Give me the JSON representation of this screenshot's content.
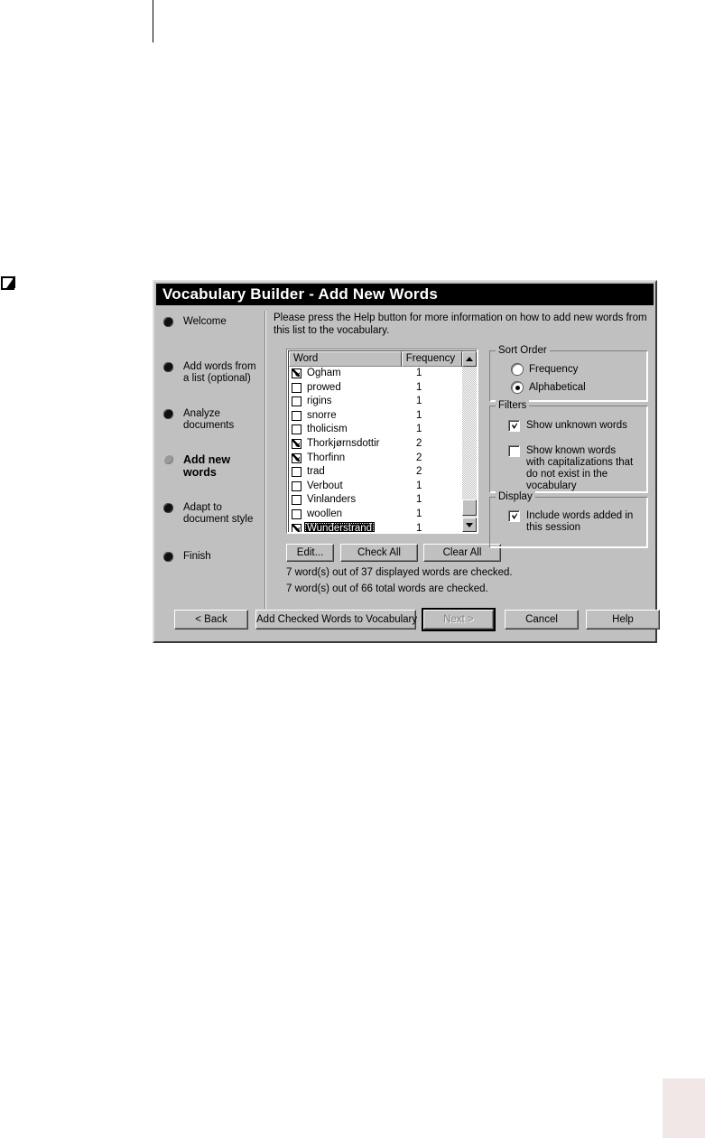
{
  "window": {
    "title": "Vocabulary Builder - Add New Words"
  },
  "steps": [
    {
      "label": "Welcome",
      "state": "done"
    },
    {
      "label": "Add words from a list (optional)",
      "state": "done"
    },
    {
      "label": "Analyze documents",
      "state": "done"
    },
    {
      "label": "Add new words",
      "state": "current"
    },
    {
      "label": "Adapt to document style",
      "state": "pending"
    },
    {
      "label": "Finish",
      "state": "pending"
    }
  ],
  "intro": "Please press the Help button for more information on how to add new words from this list to the vocabulary.",
  "list": {
    "columns": [
      "Word",
      "Frequency"
    ],
    "sort_indicator": "ascending-arrow",
    "rows": [
      {
        "checked": true,
        "word": "Ogham",
        "frequency": "1",
        "selected": false
      },
      {
        "checked": false,
        "word": "prowed",
        "frequency": "1",
        "selected": false
      },
      {
        "checked": false,
        "word": "rigins",
        "frequency": "1",
        "selected": false
      },
      {
        "checked": false,
        "word": "snorre",
        "frequency": "1",
        "selected": false
      },
      {
        "checked": false,
        "word": "tholicism",
        "frequency": "1",
        "selected": false
      },
      {
        "checked": true,
        "word": "Thorkjørnsdottir",
        "frequency": "2",
        "selected": false
      },
      {
        "checked": true,
        "word": "Thorfinn",
        "frequency": "2",
        "selected": false
      },
      {
        "checked": false,
        "word": "trad",
        "frequency": "2",
        "selected": false
      },
      {
        "checked": false,
        "word": "Verbout",
        "frequency": "1",
        "selected": false
      },
      {
        "checked": false,
        "word": "Vinlanders",
        "frequency": "1",
        "selected": false
      },
      {
        "checked": false,
        "word": "woollen",
        "frequency": "1",
        "selected": false
      },
      {
        "checked": true,
        "word": "Wunderstrand",
        "frequency": "1",
        "selected": true
      }
    ]
  },
  "list_buttons": {
    "edit": "Edit...",
    "check_all": "Check All",
    "clear_all": "Clear All"
  },
  "status": {
    "line1": "7 word(s) out of 37 displayed words are checked.",
    "line2": "7 word(s) out of 66 total words are checked."
  },
  "sort_order": {
    "title": "Sort Order",
    "options": [
      {
        "label": "Frequency",
        "selected": false
      },
      {
        "label": "Alphabetical",
        "selected": true
      }
    ]
  },
  "filters": {
    "title": "Filters",
    "options": [
      {
        "label": "Show unknown words",
        "checked": true
      },
      {
        "label": "Show known words with capitalizations that do not exist in the vocabulary",
        "checked": false
      }
    ]
  },
  "display": {
    "title": "Display",
    "options": [
      {
        "label": "Include words added in this session",
        "checked": true
      }
    ]
  },
  "bottom_buttons": {
    "back": "< Back",
    "add": "Add Checked Words to Vocabulary",
    "next": "Next >",
    "cancel": "Cancel",
    "help": "Help"
  },
  "colors": {
    "dialog_face": "#c0c0c0",
    "titlebar": "#000000",
    "titlebar_text": "#ffffff",
    "selection": "#000000",
    "corner_block": "#f1e7e7"
  },
  "page_marks": {
    "margin_icon": "checkbox-check-icon",
    "corner_block": "tinted-block"
  }
}
